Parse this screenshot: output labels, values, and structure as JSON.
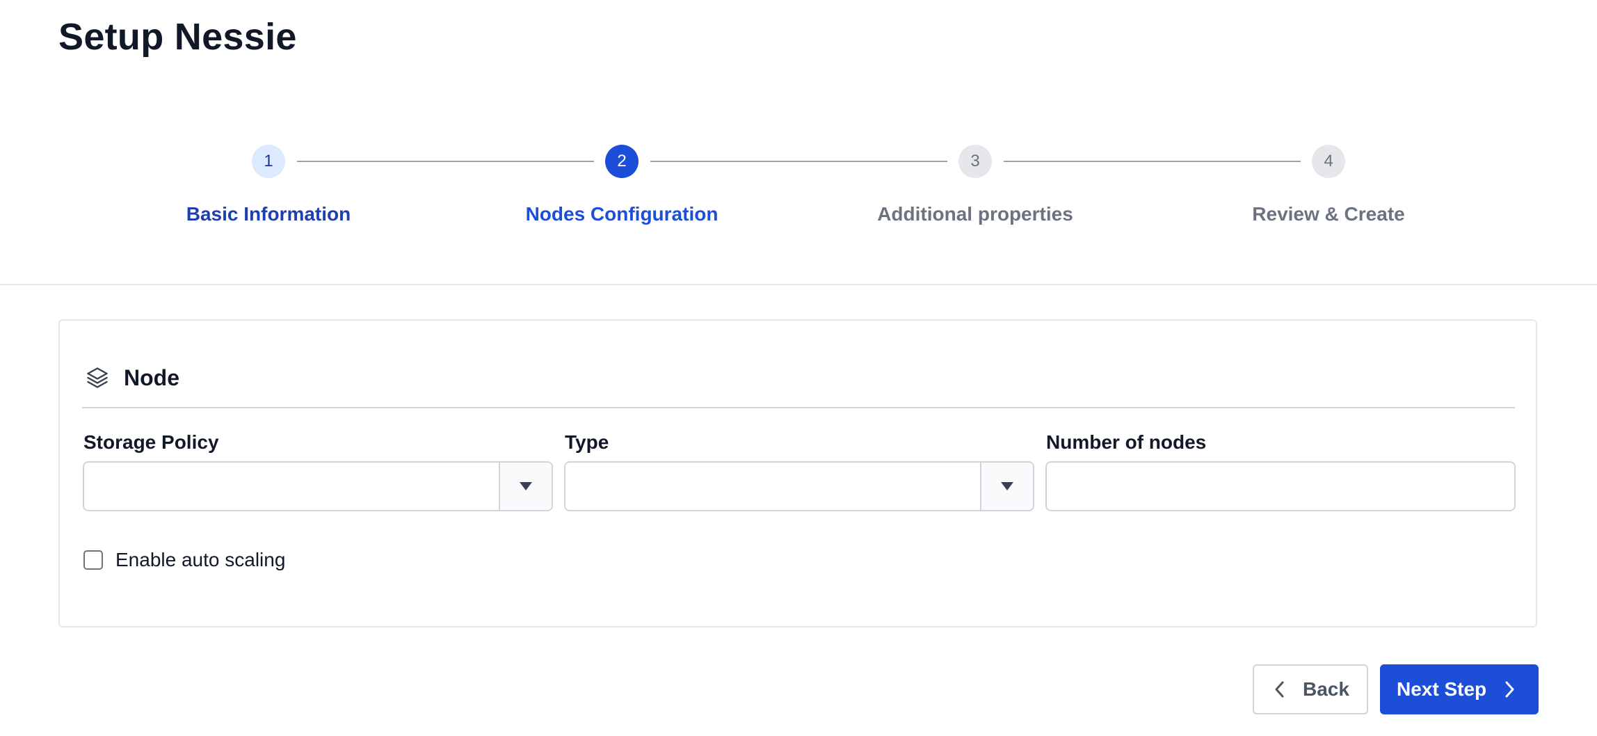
{
  "page": {
    "title": "Setup Nessie"
  },
  "stepper": {
    "steps": [
      {
        "number": "1",
        "label": "Basic Information",
        "state": "done"
      },
      {
        "number": "2",
        "label": "Nodes Configuration",
        "state": "active"
      },
      {
        "number": "3",
        "label": "Additional properties",
        "state": "upcoming"
      },
      {
        "number": "4",
        "label": "Review & Create",
        "state": "upcoming"
      }
    ]
  },
  "node_card": {
    "icon": "layers-icon",
    "title": "Node",
    "fields": {
      "storage_policy": {
        "label": "Storage Policy",
        "value": ""
      },
      "type": {
        "label": "Type",
        "value": ""
      },
      "number_of_nodes": {
        "label": "Number of nodes",
        "value": "",
        "placeholder": ""
      }
    },
    "auto_scaling": {
      "label": "Enable auto scaling",
      "checked": false
    }
  },
  "footer": {
    "back_label": "Back",
    "next_label": "Next Step"
  },
  "colors": {
    "primary": "#1d4ed8",
    "done_circle": "#dbeafe",
    "upcoming_circle": "#e5e7eb",
    "text_dark": "#111827",
    "text_muted": "#6b7280",
    "border": "#d1d5db"
  }
}
